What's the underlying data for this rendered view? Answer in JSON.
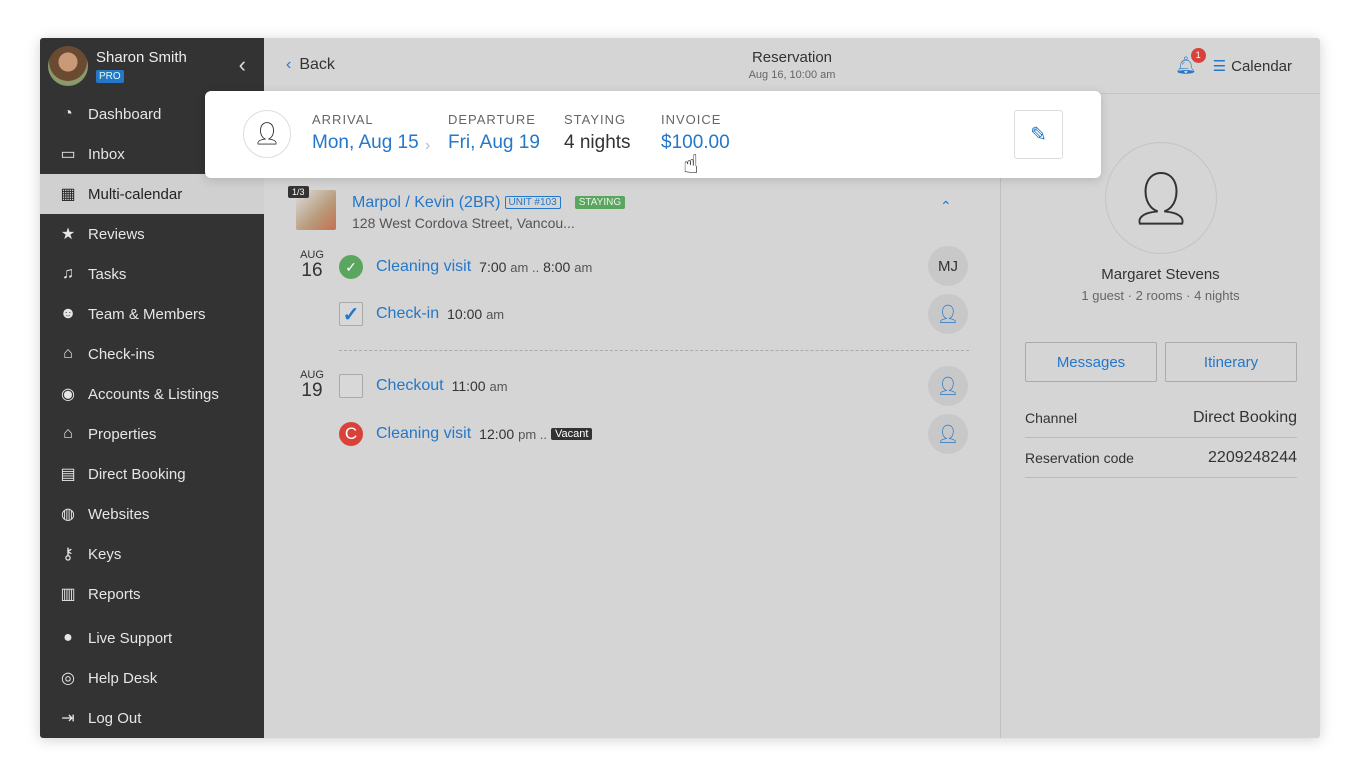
{
  "user": {
    "name": "Sharon Smith",
    "plan": "PRO"
  },
  "nav": [
    {
      "label": "Dashboard",
      "icon": "gauge-icon",
      "glyph": "◔"
    },
    {
      "label": "Inbox",
      "icon": "inbox-icon",
      "glyph": "▭"
    },
    {
      "label": "Multi-calendar",
      "icon": "calendar-icon",
      "glyph": "▦",
      "active": true
    },
    {
      "label": "Reviews",
      "icon": "star-icon",
      "glyph": "★"
    },
    {
      "label": "Tasks",
      "icon": "vacuum-icon",
      "glyph": "♫"
    },
    {
      "label": "Team & Members",
      "icon": "users-icon",
      "glyph": "☻"
    },
    {
      "label": "Check-ins",
      "icon": "bell-icon",
      "glyph": "⌂"
    },
    {
      "label": "Accounts & Listings",
      "icon": "account-icon",
      "glyph": "◉"
    },
    {
      "label": "Properties",
      "icon": "home-icon",
      "glyph": "⌂"
    },
    {
      "label": "Direct Booking",
      "icon": "code-window-icon",
      "glyph": "▤"
    },
    {
      "label": "Websites",
      "icon": "globe-icon",
      "glyph": "◍"
    },
    {
      "label": "Keys",
      "icon": "key-icon",
      "glyph": "⚷"
    },
    {
      "label": "Reports",
      "icon": "chart-icon",
      "glyph": "▥"
    },
    {
      "label": "Live Support",
      "icon": "chat-icon",
      "glyph": "●"
    },
    {
      "label": "Help Desk",
      "icon": "lifebuoy-icon",
      "glyph": "◎"
    },
    {
      "label": "Log Out",
      "icon": "logout-icon",
      "glyph": "⇥"
    }
  ],
  "header": {
    "back": "Back",
    "title": "Reservation",
    "subtitle": "Aug 16, 10:00 am",
    "notifications": "1",
    "calendar": "Calendar"
  },
  "summary": {
    "arrival_label": "ARRIVAL",
    "arrival": "Mon, Aug 15",
    "departure_label": "DEPARTURE",
    "departure": "Fri, Aug 19",
    "staying_label": "STAYING",
    "staying": "4 nights",
    "invoice_label": "INVOICE",
    "invoice": "$100.00"
  },
  "listing": {
    "photo_count": "1/3",
    "name": "Marpol / Kevin (2BR)",
    "unit": "UNIT #103",
    "status": "STAYING",
    "address": "128 West Cordova Street, Vancou..."
  },
  "days": [
    {
      "month": "AUG",
      "day": "16"
    },
    {
      "month": "AUG",
      "day": "19"
    }
  ],
  "tasks": [
    {
      "name": "Cleaning visit",
      "time": "7:00",
      "ampm": "am ..",
      "time2": "8:00",
      "ampm2": "am",
      "assignee": "MJ",
      "status": "done"
    },
    {
      "name": "Check-in",
      "time": "10:00",
      "ampm": "am",
      "status": "checked"
    },
    {
      "name": "Checkout",
      "time": "11:00",
      "ampm": "am",
      "status": "unchecked"
    },
    {
      "name": "Cleaning visit",
      "time": "12:00",
      "ampm": "pm ..",
      "tag": "Vacant",
      "status": "C"
    }
  ],
  "guest": {
    "name": "Margaret Stevens",
    "details": "1 guest · 2 rooms · 4 nights",
    "messages": "Messages",
    "itinerary": "Itinerary",
    "channel_label": "Channel",
    "channel": "Direct Booking",
    "code_label": "Reservation code",
    "code": "2209248244"
  },
  "colors": {
    "accent": "#2477c9",
    "sidebar": "#333333",
    "success": "#5aa65e",
    "danger": "#d9423a"
  }
}
